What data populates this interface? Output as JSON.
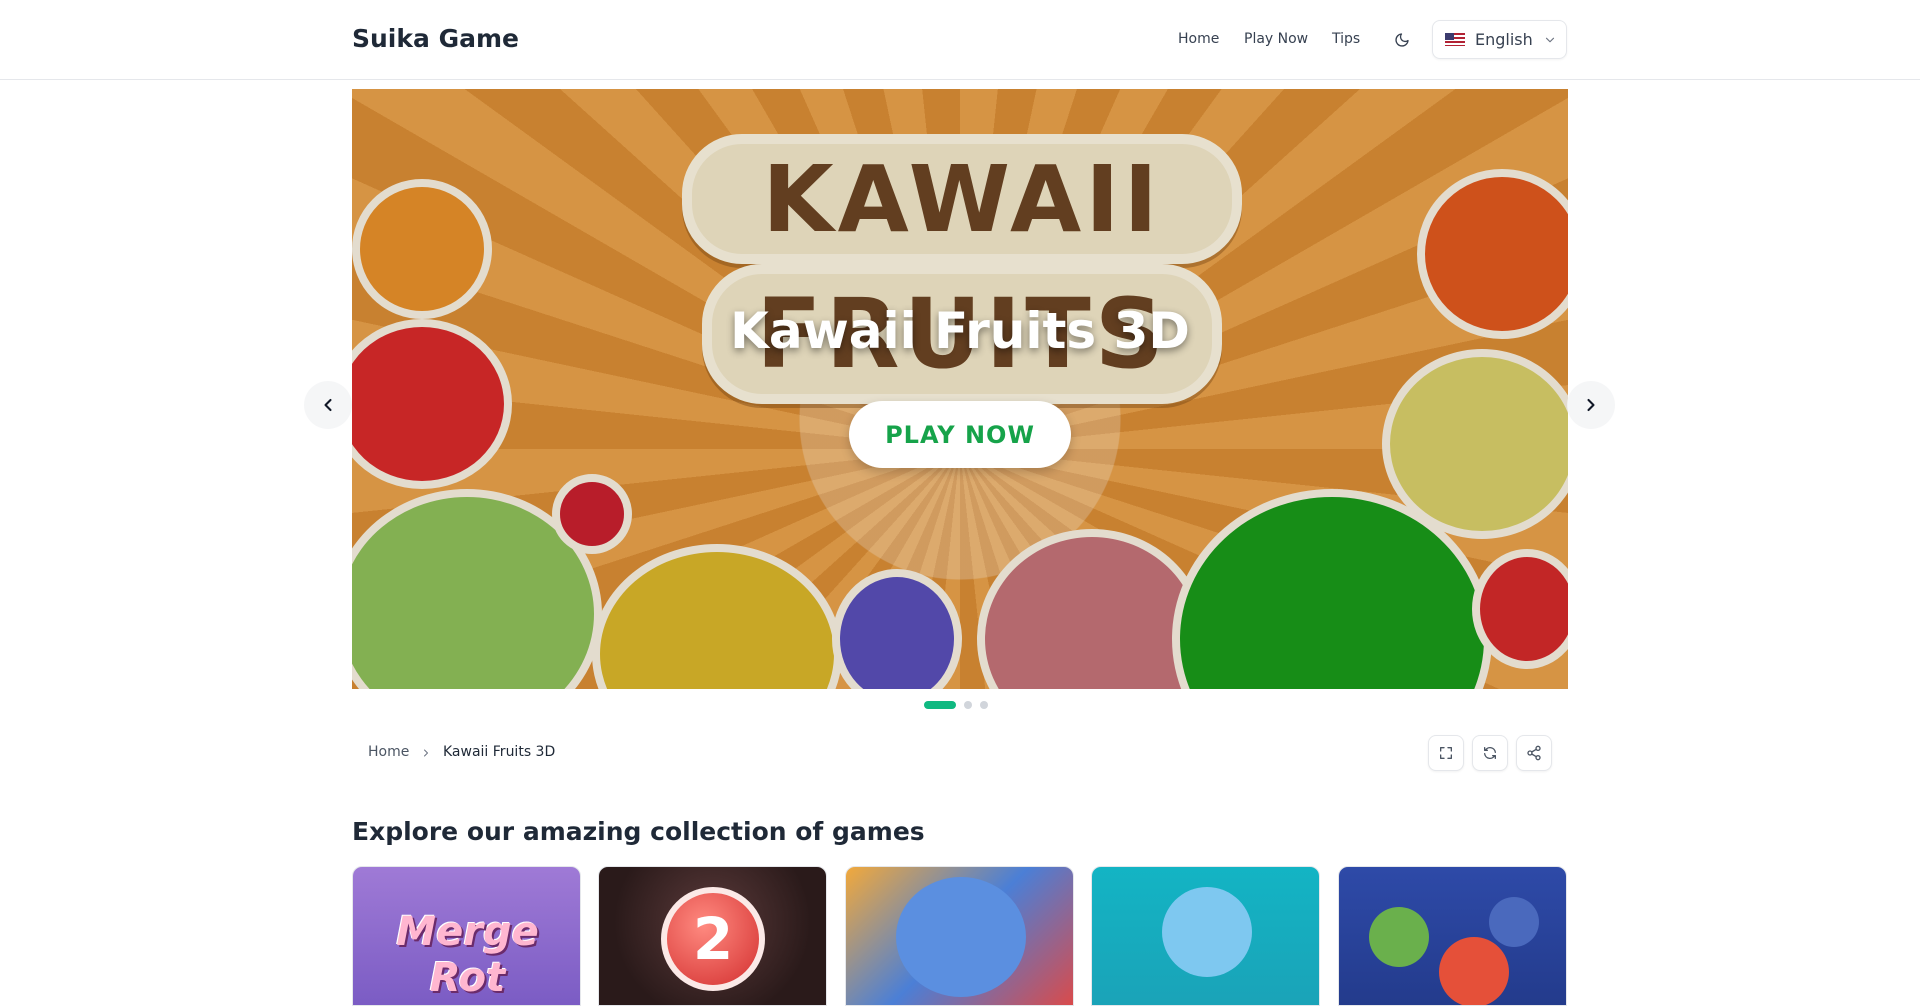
{
  "header": {
    "brand": "Suika Game",
    "nav": {
      "home": "Home",
      "play_now": "Play Now",
      "tips": "Tips"
    },
    "theme_icon": "moon-icon",
    "language": {
      "label": "English",
      "flag_icon": "us-flag-icon",
      "chevron_icon": "chevron-down-icon"
    }
  },
  "hero": {
    "art_text": {
      "line1": "KAWAII",
      "line2": "FRUITS"
    },
    "title": "Kawaii Fruits 3D",
    "play_button": "PLAY NOW",
    "prev_icon": "chevron-left-icon",
    "next_icon": "chevron-right-icon",
    "slides": {
      "count": 3,
      "active_index": 0
    },
    "accent_color": "#10b981",
    "play_text_color": "#16a34a"
  },
  "breadcrumb": {
    "home": "Home",
    "current": "Kawaii Fruits 3D"
  },
  "tools": {
    "fullscreen_icon": "fullscreen-icon",
    "reload_icon": "reload-icon",
    "share_icon": "share-icon"
  },
  "section": {
    "title": "Explore our amazing collection of games"
  },
  "cards": [
    {
      "art_text": "Merge Rot"
    },
    {
      "art_text": "2"
    },
    {
      "art_text": ""
    },
    {
      "art_text": ""
    },
    {
      "art_text": ""
    }
  ]
}
